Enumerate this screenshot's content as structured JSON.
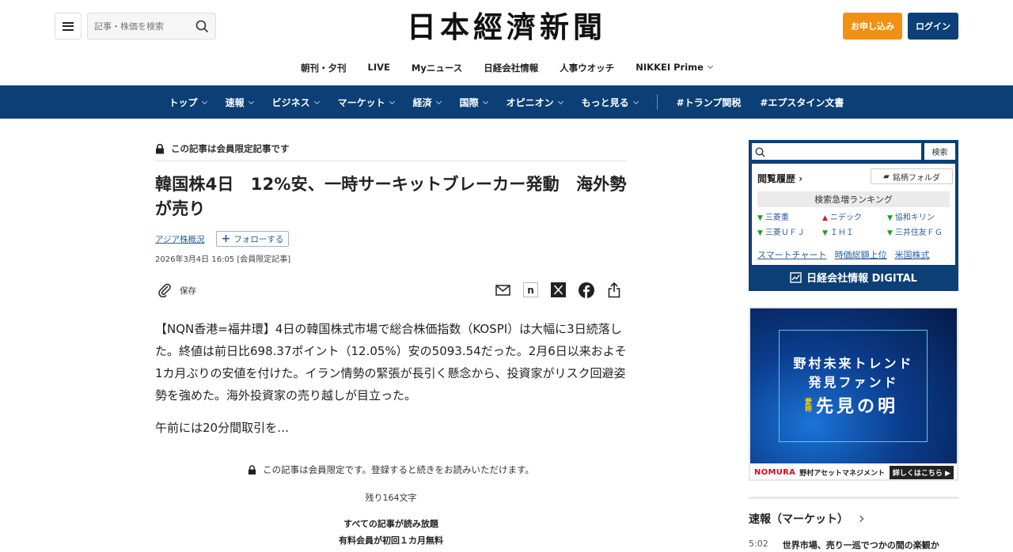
{
  "header": {
    "search_placeholder": "記事・株価を検索",
    "logo": "日本經濟新聞",
    "apply_label": "お申し込み",
    "login_label": "ログイン",
    "subnav": [
      "朝刊・夕刊",
      "LIVE",
      "Myニュース",
      "日経会社情報",
      "人事ウオッチ",
      "NIKKEI Prime"
    ]
  },
  "mainnav": {
    "items": [
      "トップ",
      "速報",
      "ビジネス",
      "マーケット",
      "経済",
      "国際",
      "オピニオン",
      "もっと見る"
    ],
    "hashtags": [
      "#トランプ関税",
      "#エプスタイン文書"
    ]
  },
  "article": {
    "members_only": "この記事は会員限定記事です",
    "title": "韓国株4日　12%安、一時サーキットブレーカー発動　海外勢が売り",
    "topic_link": "アジア株概況",
    "follow_label": "フォローする",
    "date": "2026年3月4日 16:05  [会員限定記事]",
    "save_label": "保存",
    "body": "【NQN香港=福井環】4日の韓国株式市場で総合株価指数（KOSPI）は大幅に3日続落した。終値は前日比698.37ポイント（12.05%）安の5093.54だった。2月6日以来およそ1カ月ぶりの安値を付けた。イラン情勢の緊張が長引く懸念から、投資家がリスク回避姿勢を強めた。海外投資家の売り越しが目立った。",
    "body_more": "午前には20分間取引を…",
    "lock_message": "この記事は会員限定です。登録すると続きをお読みいただけます。",
    "remaining": "残り164文字",
    "promo_line1": "すべての記事が読み放題",
    "promo_line2": "有料会員が初回１カ月無料"
  },
  "widget": {
    "search_button": "検索",
    "history_label": "閲覧履歴",
    "folder_label": "銘柄フォルダ",
    "ranking_header": "検索急増ランキング",
    "ranking": [
      {
        "name": "三菱重",
        "trend": "down"
      },
      {
        "name": "ニデック",
        "trend": "up"
      },
      {
        "name": "協和キリン",
        "trend": "down"
      },
      {
        "name": "三菱ＵＦＪ",
        "trend": "down"
      },
      {
        "name": "ＩＨＩ",
        "trend": "down"
      },
      {
        "name": "三井住友ＦＧ",
        "trend": "down"
      }
    ],
    "links": [
      "スマートチャート",
      "時価総額上位",
      "米国株式"
    ],
    "brand": "日経会社情報 DIGITAL"
  },
  "ad": {
    "line1": "野村未来トレンド",
    "line2": "発見ファンド",
    "nickname": "愛称",
    "main": "先見の明",
    "brand": "NOMURA",
    "company": "野村アセットマネジメント",
    "cta": "詳しくはこちら"
  },
  "sidebar_news": {
    "heading": "速報（マーケット）",
    "items": [
      {
        "time": "5:02",
        "title": "世界市場、売り一巡でつかの間の楽観か"
      }
    ]
  },
  "colors": {
    "navy": "#0b3f75",
    "orange": "#f19114",
    "link": "#2a5ea0",
    "down_green": "#1ba11b",
    "up_red": "#d02020"
  }
}
